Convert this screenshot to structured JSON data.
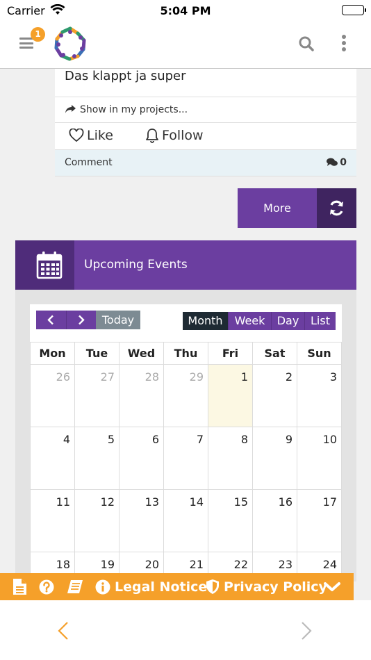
{
  "status_bar": {
    "carrier": "Carrier",
    "time": "5:04 PM"
  },
  "header": {
    "notification_count": "1"
  },
  "post": {
    "text": "Das klappt ja super",
    "share_label": "Show in my projects...",
    "like_label": "Like",
    "follow_label": "Follow",
    "comment_label": "Comment",
    "comment_count": "0"
  },
  "more_button": {
    "label": "More"
  },
  "events": {
    "title": "Upcoming Events",
    "today_label": "Today",
    "views": [
      "Month",
      "Week",
      "Day",
      "List"
    ],
    "active_view": "Month",
    "weekdays": [
      "Mon",
      "Tue",
      "Wed",
      "Thu",
      "Fri",
      "Sat",
      "Sun"
    ],
    "weeks": [
      [
        "26",
        "27",
        "28",
        "29",
        "1",
        "2",
        "3"
      ],
      [
        "4",
        "5",
        "6",
        "7",
        "8",
        "9",
        "10"
      ],
      [
        "11",
        "12",
        "13",
        "14",
        "15",
        "16",
        "17"
      ],
      [
        "18",
        "19",
        "20",
        "21",
        "22",
        "23",
        "24"
      ]
    ]
  },
  "footer": {
    "legal_notice": "Legal Notice",
    "privacy_policy": "Privacy Policy"
  },
  "colors": {
    "purple": "#6b3ea0",
    "dark_purple": "#3f2460",
    "orange": "#f5a02a",
    "today_highlight": "#fcf8e3"
  }
}
